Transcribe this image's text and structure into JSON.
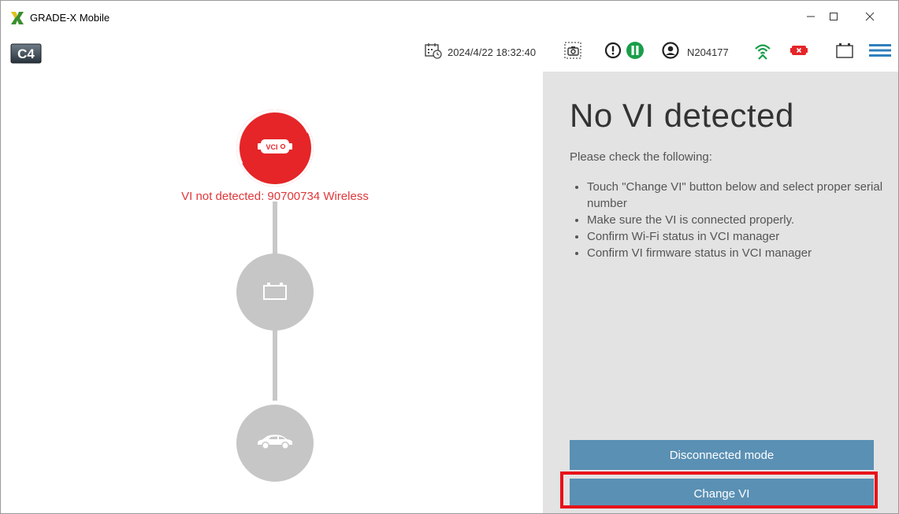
{
  "window": {
    "title": "GRADE-X Mobile",
    "controls": {
      "minimize": "minimize",
      "maximize": "maximize",
      "close": "close"
    }
  },
  "toolbar": {
    "logo_text": "C4",
    "datetime": "2024/4/22 18:32:40",
    "user_id": "N204177",
    "icons": [
      "calendar-clock-icon",
      "screenshot-icon",
      "alert-icon",
      "pause-icon",
      "user-icon",
      "wireless-icon",
      "vci-status-icon",
      "battery-icon",
      "menu-icon"
    ]
  },
  "steps": {
    "vci": {
      "icon_text": "VCI",
      "status_label": "VI not detected: 90700734 Wireless"
    },
    "battery": {
      "icon": "battery-icon"
    },
    "vehicle": {
      "icon": "car-icon"
    }
  },
  "panel": {
    "heading": "No VI detected",
    "intro": "Please check the following:",
    "checklist": [
      "Touch \"Change VI\" button below and select proper serial number",
      "Make sure the VI is connected properly.",
      "Confirm Wi-Fi status in VCI manager",
      "Confirm VI firmware status in VCI manager"
    ],
    "disconnected_label": "Disconnected mode",
    "change_label": "Change VI"
  },
  "colors": {
    "accent_red": "#e52528",
    "button_blue": "#5a90b4",
    "panel_grey": "#e3e3e3",
    "step_grey": "#c6c6c6",
    "ok_green": "#1a9e4a",
    "menu_blue": "#2f7fbd"
  }
}
